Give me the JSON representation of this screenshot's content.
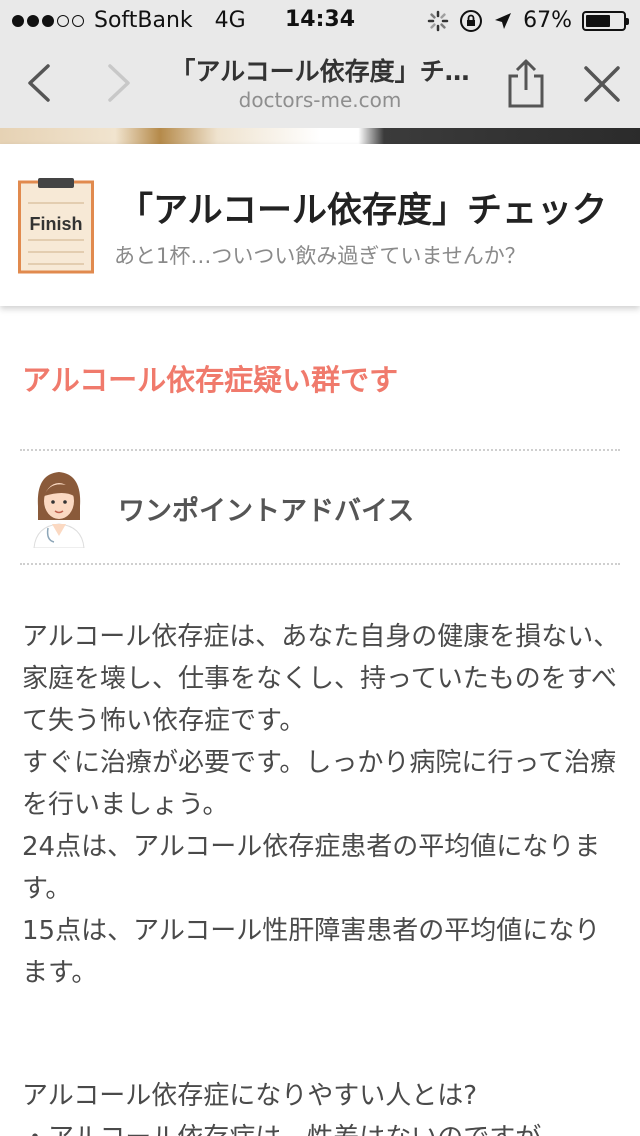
{
  "status_bar": {
    "carrier": "SoftBank",
    "network": "4G",
    "time": "14:34",
    "battery": "67%",
    "battery_level": 0.67,
    "signal_bars": 3
  },
  "browser": {
    "page_title": "「アルコール依存度」チ…",
    "domain": "doctors-me.com"
  },
  "header": {
    "icon_label": "Finish",
    "title": "「アルコール依存度」チェック",
    "subtitle": "あと1杯…ついつい飲み過ぎていませんか？"
  },
  "result": {
    "text": "アルコール依存症疑い群です",
    "color": "#f07a6c"
  },
  "advice": {
    "heading": "ワンポイントアドバイス",
    "paragraphs": [
      "アルコール依存症は、あなた自身の健康を損ない、家庭を壊し、仕事をなくし、持っていたものをすべて失う怖い依存症です。",
      "すぐに治療が必要です。しっかり病院に行って治療を行いましょう。",
      "24点は、アルコール依存症患者の平均値になります。",
      "15点は、アルコール性肝障害患者の平均値になります。"
    ],
    "next_heading": "アルコール依存症になりやすい人とは?",
    "cut_line": "・アルコール依存症は、性差はないのですが、"
  }
}
